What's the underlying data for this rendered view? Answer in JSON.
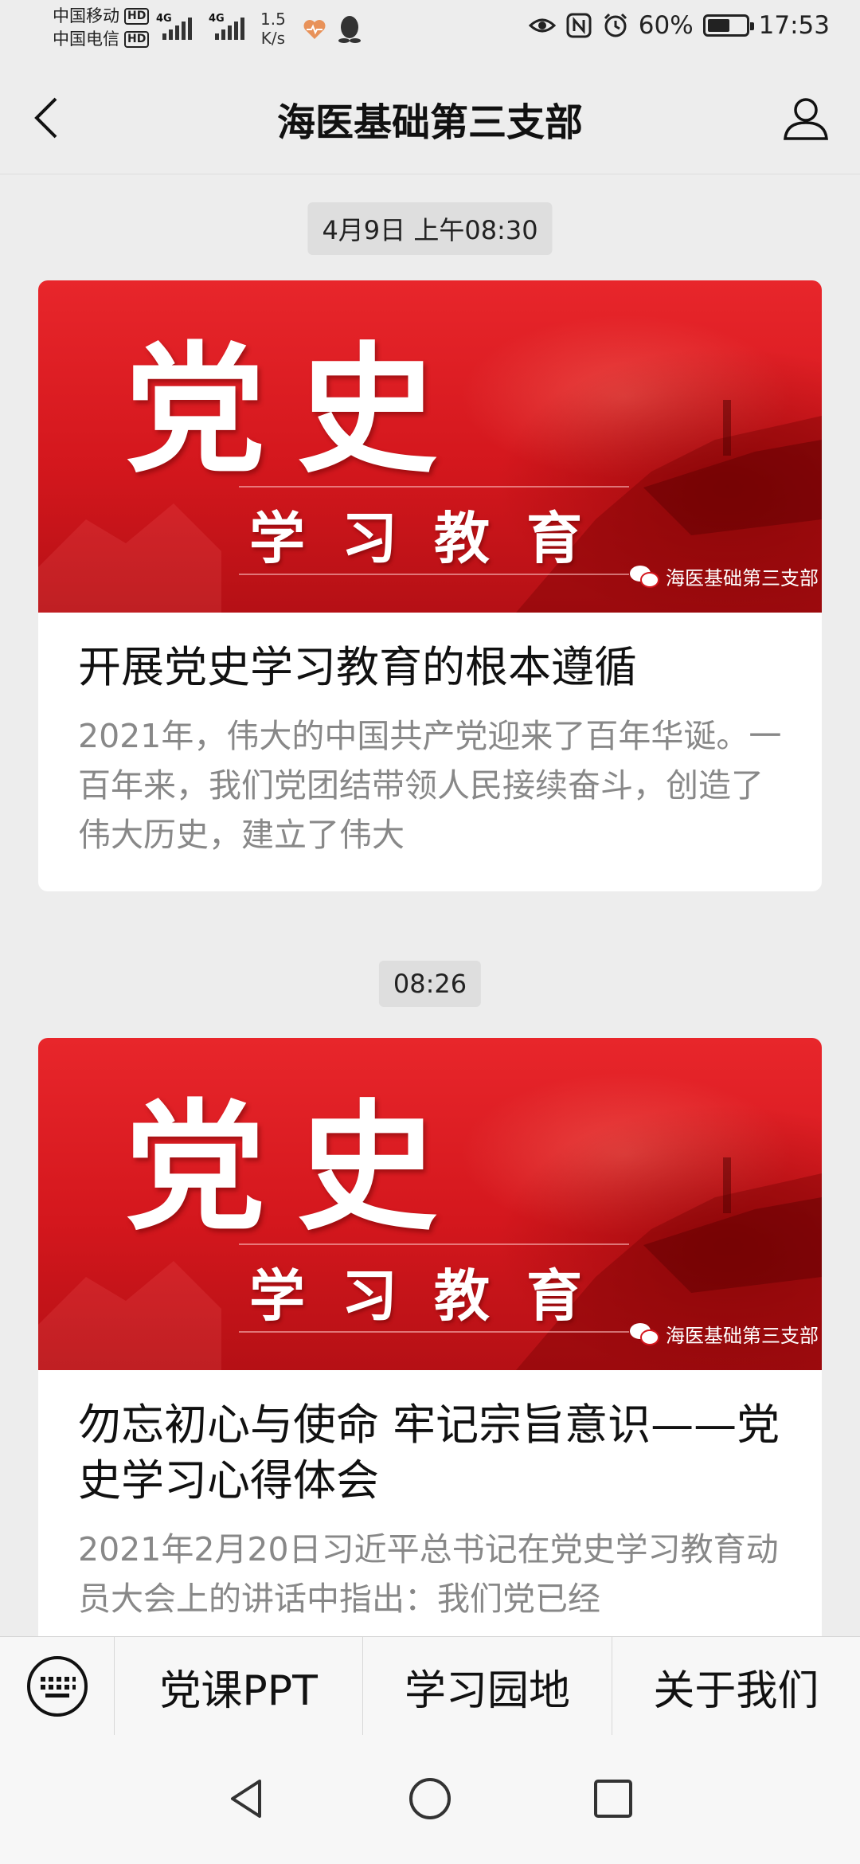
{
  "status_bar": {
    "carrier_1": "中国移动",
    "carrier_2": "中国电信",
    "hd_badge": "HD",
    "network_1": "4G",
    "network_2": "4G",
    "speed_value": "1.5",
    "speed_unit": "K/s",
    "battery_percent": "60%",
    "battery_level": 0.6,
    "time": "17:53",
    "icons": [
      "heart-rate-icon",
      "qq-icon",
      "eye-icon",
      "nfc-icon",
      "alarm-icon",
      "battery-icon"
    ]
  },
  "header": {
    "title": "海医基础第三支部",
    "back_icon": "chevron-left-icon",
    "profile_icon": "user-icon"
  },
  "feed": {
    "messages": [
      {
        "timestamp": "4月9日 上午08:30",
        "banner_big": "党史",
        "banner_small": "学习教育",
        "watermark": "海医基础第三支部",
        "title": "开展党史学习教育的根本遵循",
        "summary": "2021年，伟大的中国共产党迎来了百年华诞。一百年来，我们党团结带领人民接续奋斗，创造了伟大历史，建立了伟大"
      },
      {
        "timestamp": "08:26",
        "banner_big": "党史",
        "banner_small": "学习教育",
        "watermark": "海医基础第三支部",
        "title": "勿忘初心与使命 牢记宗旨意识——党史学习心得体会",
        "summary": "2021年2月20日习近平总书记在党史学习教育动员大会上的讲话中指出：我们党已经"
      }
    ]
  },
  "bottom_menu": {
    "keyboard_icon": "keyboard-icon",
    "items": [
      "党课PPT",
      "学习园地",
      "关于我们"
    ]
  },
  "nav_bar": {
    "icons": [
      "nav-back-icon",
      "nav-home-icon",
      "nav-recents-icon"
    ]
  },
  "colors": {
    "banner_red": "#d4171d",
    "background": "#ededed",
    "summary_gray": "#888888"
  }
}
